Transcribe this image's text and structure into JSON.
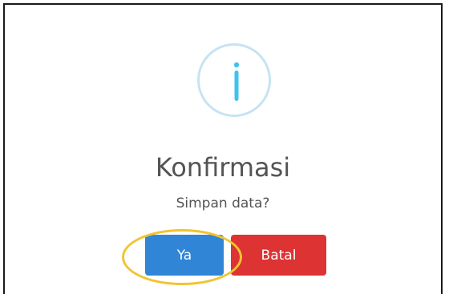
{
  "dialog": {
    "icon": "info-icon",
    "title": "Konfirmasi",
    "message": "Simpan data?",
    "confirm_label": "Ya",
    "cancel_label": "Batal"
  },
  "colors": {
    "icon_ring": "#c6e3f3",
    "icon_glyph": "#3fc3ee",
    "text": "#545454",
    "confirm_button": "#3085d6",
    "cancel_button": "#dd3333",
    "highlight": "#f2c431"
  }
}
